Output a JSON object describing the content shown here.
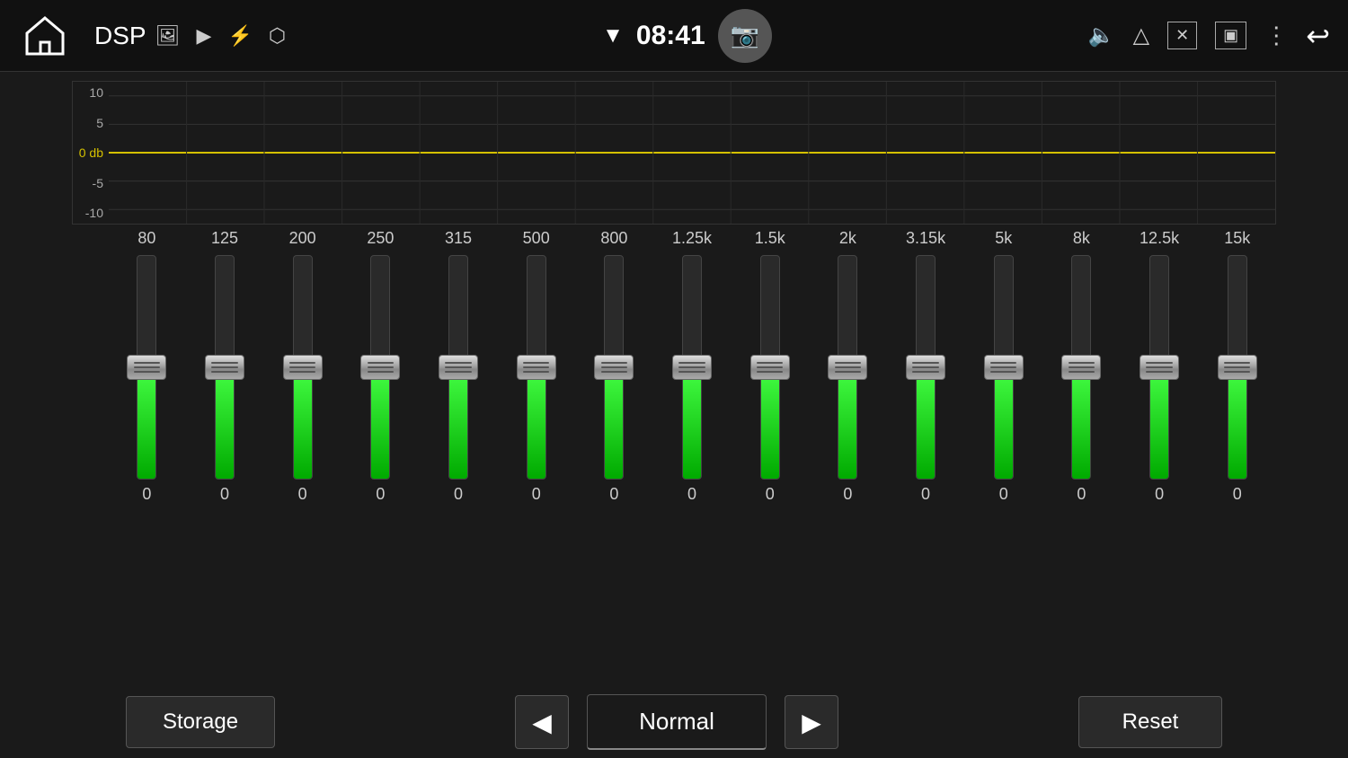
{
  "statusBar": {
    "title": "DSP",
    "time": "08:41",
    "icons": {
      "wifi": "▼",
      "volume": "🔈",
      "triangle": "△",
      "close": "✕",
      "window": "▣",
      "more": "⋮",
      "back": "↩"
    }
  },
  "graph": {
    "labels": [
      "10",
      "5",
      "0 db",
      "-5",
      "-10"
    ],
    "zeroLineLabel": "0 db",
    "zeroLinePercent": 60
  },
  "frequencies": [
    "80",
    "125",
    "200",
    "250",
    "315",
    "500",
    "800",
    "1.25k",
    "1.5k",
    "2k",
    "3.15k",
    "5k",
    "8k",
    "12.5k",
    "15k"
  ],
  "sliders": [
    {
      "value": "0",
      "fill": 50
    },
    {
      "value": "0",
      "fill": 50
    },
    {
      "value": "0",
      "fill": 50
    },
    {
      "value": "0",
      "fill": 50
    },
    {
      "value": "0",
      "fill": 50
    },
    {
      "value": "0",
      "fill": 50
    },
    {
      "value": "0",
      "fill": 50
    },
    {
      "value": "0",
      "fill": 50
    },
    {
      "value": "0",
      "fill": 50
    },
    {
      "value": "0",
      "fill": 50
    },
    {
      "value": "0",
      "fill": 50
    },
    {
      "value": "0",
      "fill": 50
    },
    {
      "value": "0",
      "fill": 50
    },
    {
      "value": "0",
      "fill": 50
    },
    {
      "value": "0",
      "fill": 50
    }
  ],
  "bottomBar": {
    "storageLabel": "Storage",
    "prevLabel": "◀",
    "presetLabel": "Normal",
    "nextLabel": "▶",
    "resetLabel": "Reset"
  }
}
